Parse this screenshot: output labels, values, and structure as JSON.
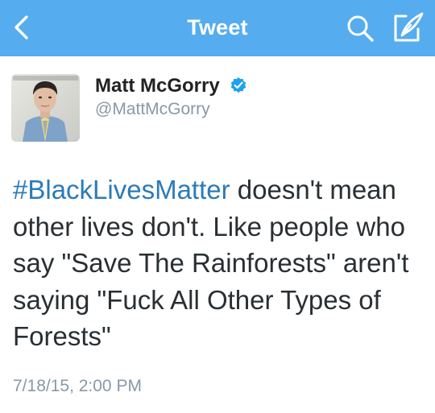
{
  "nav": {
    "title": "Tweet",
    "back_icon": "chevron-left-icon",
    "search_icon": "search-icon",
    "compose_icon": "compose-icon",
    "bar_color": "#55acee"
  },
  "author": {
    "name": "Matt McGorry",
    "handle": "@MattMcGorry",
    "verified": true,
    "verified_icon": "verified-badge-icon",
    "verified_color": "#1da1f2"
  },
  "tweet": {
    "hashtag": "#BlackLivesMatter",
    "body": " doesn't mean other lives don't. Like people who say \"Save The Rainforests\" aren't saying \"Fuck All Other Types of Forests\"",
    "hashtag_color": "#2b7bb9",
    "timestamp": "7/18/15, 2:00 PM"
  }
}
